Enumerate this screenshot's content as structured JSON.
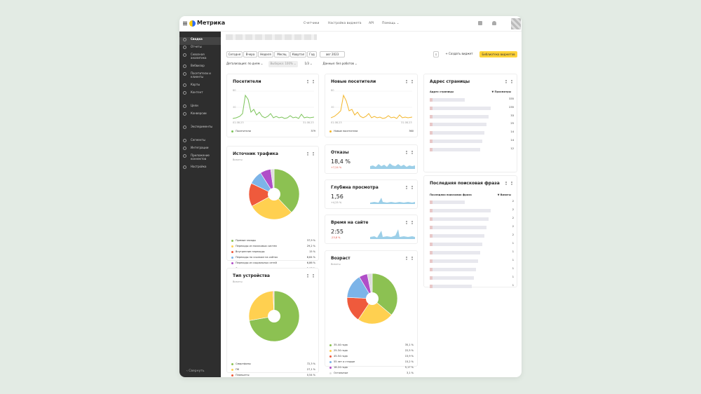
{
  "app": {
    "brand": "Метрика"
  },
  "topnav": [
    "Счетчики",
    "Настройка виджета",
    "API",
    "Помощь ⌄"
  ],
  "sidebar": {
    "items": [
      "Сводка",
      "Отчеты",
      "Сквозная аналитика",
      "Вебвизор",
      "Посетители и клиенты",
      "Карты",
      "Контент",
      "Цели",
      "Конверсии",
      "Эксперименты",
      "Сегменты",
      "Интеграции",
      "Приложение коннектов",
      "Настройка"
    ],
    "collapse": "‹ Свернуть"
  },
  "period": [
    "Сегодня",
    "Вчера",
    "Неделя",
    "Месяц",
    "Квартал",
    "Год"
  ],
  "date_btn": "авг 2023",
  "filters": {
    "detail": "Детализация: по дням ⌄",
    "sample": "Выборка: 100% ⌄",
    "count": "1/3 ⌄",
    "robots": "Данные: без роботов ⌄"
  },
  "actions": {
    "create": "+ Создать виджет",
    "library": "Библиотека виджетов"
  },
  "visitors": {
    "title": "Посетители",
    "y_top": "80",
    "y_mid": "40",
    "x0": "01.08.23",
    "x1": "31.08.23",
    "legend": "Посетители",
    "value": "379",
    "color": "#7cc45a"
  },
  "new_visitors": {
    "title": "Новые посетители",
    "y_top": "80",
    "y_mid": "40",
    "x0": "01.08.23",
    "x1": "31.08.23",
    "legend": "Новые посетители",
    "value": "360",
    "color": "#f3b62a"
  },
  "bounce": {
    "title": "Отказы",
    "value": "18,4 %",
    "delta": "+7,24 %",
    "delta_color": "#e04a3c"
  },
  "depth": {
    "title": "Глубина просмотра",
    "value": "1,56",
    "delta": "+4,25 %",
    "delta_color": "#888"
  },
  "time": {
    "title": "Время на сайте",
    "value": "2:55",
    "delta": "-23,8 %",
    "delta_color": "#e04a3c"
  },
  "traffic": {
    "title": "Источник трафика",
    "sub": "Визиты",
    "items": [
      {
        "label": "Прямые заходы",
        "value": "37,9 %",
        "color": "#8cc152"
      },
      {
        "label": "Переходы из поисковых систем",
        "value": "29,2 %",
        "color": "#ffd050"
      },
      {
        "label": "Внутренние переходы",
        "value": "15 %",
        "color": "#ef5a3c"
      },
      {
        "label": "Переходы по ссылкам на сайтах",
        "value": "8,84 %",
        "color": "#7cb4e8"
      },
      {
        "label": "Переходы из социальных сетей",
        "value": "6,86 %",
        "color": "#b04ec8"
      },
      {
        "label": "Остальные",
        "value": "2,17 %",
        "color": "#dddddd"
      }
    ]
  },
  "device": {
    "title": "Тип устройства",
    "sub": "Визиты",
    "items": [
      {
        "label": "Смартфоны",
        "value": "72,3 %",
        "color": "#8cc152"
      },
      {
        "label": "ПК",
        "value": "27,1 %",
        "color": "#ffd050"
      },
      {
        "label": "Планшеты",
        "value": "0,54 %",
        "color": "#ef5a3c"
      },
      {
        "label": "ТВ",
        "value": "0,18 %",
        "color": "#7cb4e8"
      }
    ]
  },
  "age": {
    "title": "Возраст",
    "sub": "Визиты",
    "items": [
      {
        "label": "35-44 года",
        "value": "35,1 %",
        "color": "#8cc152"
      },
      {
        "label": "25-34 года",
        "value": "22,5 %",
        "color": "#ffd050"
      },
      {
        "label": "45-54 года",
        "value": "15,9 %",
        "color": "#ef5a3c"
      },
      {
        "label": "55 лет и старше",
        "value": "15,2 %",
        "color": "#7cb4e8"
      },
      {
        "label": "18-24 года",
        "value": "5,17 %",
        "color": "#b04ec8"
      },
      {
        "label": "Остальные",
        "value": "3,1 %",
        "color": "#dddddd"
      }
    ]
  },
  "pages": {
    "title": "Адрес страницы",
    "col1": "Адрес страницы",
    "col2": "▼ Просмотры",
    "values": [
      "335",
      "235",
      "33",
      "25",
      "14",
      "14",
      "12"
    ]
  },
  "phrases": {
    "title": "Последняя поисковая фраза",
    "col1": "Последняя поисковая фраза",
    "col2": "▼ Визиты",
    "values": [
      "2",
      "2",
      "2",
      "2",
      "2",
      "1",
      "1",
      "1",
      "1",
      "1",
      "1"
    ]
  }
}
